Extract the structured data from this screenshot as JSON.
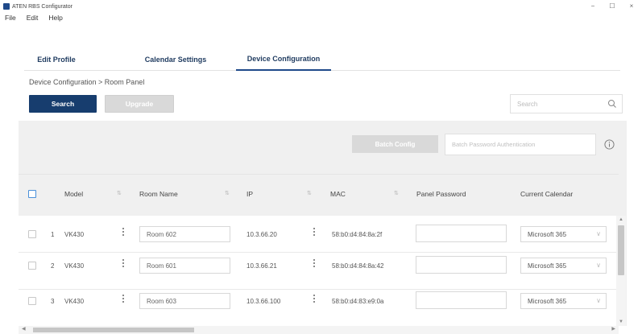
{
  "window": {
    "title": "ATEN RBS Configurator",
    "controls": [
      "−",
      "☐",
      "×"
    ]
  },
  "menu": {
    "items": [
      "File",
      "Edit",
      "Help"
    ]
  },
  "tabs": [
    {
      "label": "Edit Profile",
      "active": false
    },
    {
      "label": "Calendar Settings",
      "active": false
    },
    {
      "label": "Device Configuration",
      "active": true
    }
  ],
  "breadcrumb": "Device Configuration > Room Panel",
  "toolbar": {
    "search_label": "Search",
    "upgrade_label": "Upgrade",
    "search_placeholder": "Search"
  },
  "batch": {
    "config_label": "Batch Config",
    "password_placeholder": "Batch Password Authentication"
  },
  "table": {
    "columns": [
      "Model",
      "Room Name",
      "IP",
      "MAC",
      "Panel Password",
      "Current Calendar"
    ],
    "rows": [
      {
        "index": "1",
        "model": "VK430",
        "room_name": "Room 602",
        "ip": "10.3.66.20",
        "mac": "58:b0:d4:84:8a:2f",
        "calendar": "Microsoft 365"
      },
      {
        "index": "2",
        "model": "VK430",
        "room_name": "Room 601",
        "ip": "10.3.66.21",
        "mac": "58:b0:d4:84:8a:42",
        "calendar": "Microsoft 365"
      },
      {
        "index": "3",
        "model": "VK430",
        "room_name": "Room 603",
        "ip": "10.3.66.100",
        "mac": "58:b0:d4:83:e9:0a",
        "calendar": "Microsoft 365"
      }
    ]
  },
  "colors": {
    "accent": "#173d6e",
    "panel_bg": "#f0f0f0",
    "disabled_btn": "#d9d9d9"
  }
}
